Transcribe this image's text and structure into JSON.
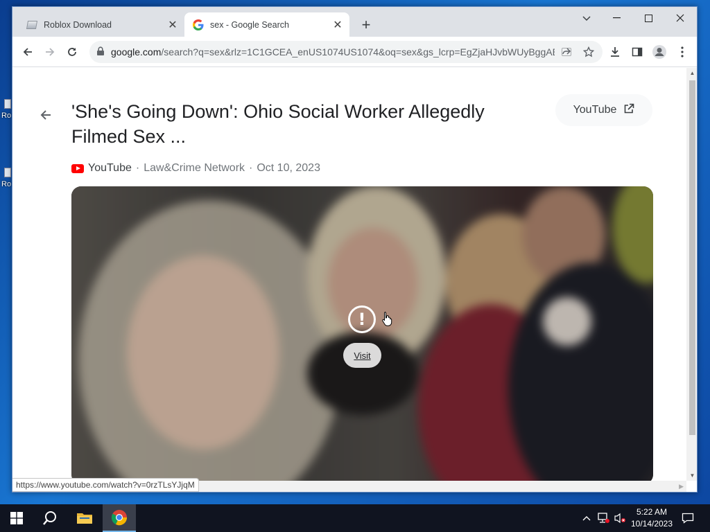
{
  "desktop": {
    "icons": [
      {
        "label": "Ro"
      },
      {
        "label": "Ro"
      }
    ]
  },
  "browser": {
    "tabs": [
      {
        "title": "Roblox Download",
        "active": false,
        "favicon": "roblox-favicon"
      },
      {
        "title": "sex - Google Search",
        "active": true,
        "favicon": "google-favicon"
      }
    ],
    "new_tab_label": "+",
    "url_host": "google.com",
    "url_rest": "/search?q=sex&rlz=1C1GCEA_enUS1074US1074&oq=sex&gs_lcrp=EgZjaHJvbWUyBggAE...",
    "status_url": "https://www.youtube.com/watch?v=0rzTLsYJjqM"
  },
  "result": {
    "headline": "'She's Going Down': Ohio Social Worker Allegedly Filmed Sex ...",
    "source_pill_label": "YouTube",
    "meta_source": "YouTube",
    "meta_channel": "Law&Crime Network",
    "meta_date": "Oct 10, 2023",
    "separator": "·",
    "warning_glyph": "!",
    "visit_label": "Visit"
  },
  "taskbar": {
    "time": "5:22 AM",
    "date": "10/14/2023"
  },
  "colors": {
    "youtube_red": "#ff0000",
    "taskbar_bg": "#101420",
    "tab_strip": "#dee1e6"
  }
}
